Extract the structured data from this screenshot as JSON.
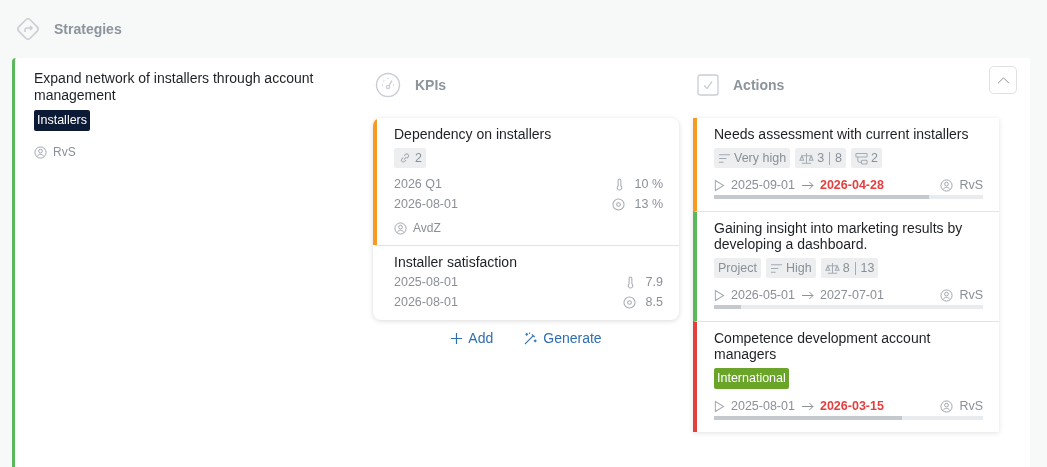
{
  "section": {
    "title": "Strategies"
  },
  "strategy": {
    "title": "Expand network of installers through account management",
    "color": "#5cb85c",
    "tags": [
      {
        "label": "Installers",
        "color": "#0c1a36"
      }
    ],
    "owner": "RvS"
  },
  "kpis": {
    "title": "KPIs",
    "items": [
      {
        "title": "Dependency on installers",
        "color": "#f59a23",
        "links": "2",
        "period": "2026 Q1",
        "date": "2026-08-01",
        "current": "10 %",
        "target": "13 %",
        "owner": "AvdZ"
      },
      {
        "title": "Installer satisfaction",
        "period": "2025-08-01",
        "date": "2026-08-01",
        "current": "7.9",
        "target": "8.5"
      }
    ],
    "add": "Add",
    "generate": "Generate"
  },
  "actions": {
    "title": "Actions",
    "expanded": true,
    "items": [
      {
        "title": "Needs assessment with current installers",
        "color": "#f59a23",
        "tags": [
          {
            "kind": "priority",
            "label": "Very high"
          },
          {
            "kind": "effort",
            "a": "3",
            "b": "8"
          },
          {
            "kind": "subtasks",
            "label": "2"
          }
        ],
        "start": "2025-09-01",
        "end": "2026-04-28",
        "overdue": true,
        "owner": "RvS",
        "level": 0.8
      },
      {
        "title": "Gaining insight into marketing results by developing a dashboard.",
        "color": "#5cb85c",
        "tags": [
          {
            "kind": "label",
            "label": "Project"
          },
          {
            "kind": "priority",
            "label": "High"
          },
          {
            "kind": "effort",
            "a": "8",
            "b": "13"
          }
        ],
        "start": "2026-05-01",
        "end": "2027-07-01",
        "overdue": false,
        "owner": "RvS",
        "level": 0.1
      },
      {
        "title": "Competence development account managers",
        "color": "#e53e3e",
        "tags": [
          {
            "kind": "tag",
            "label": "International",
            "color": "#6aa52a"
          }
        ],
        "start": "2025-08-01",
        "end": "2026-03-15",
        "overdue": true,
        "owner": "RvS",
        "level": 0.7
      }
    ]
  }
}
